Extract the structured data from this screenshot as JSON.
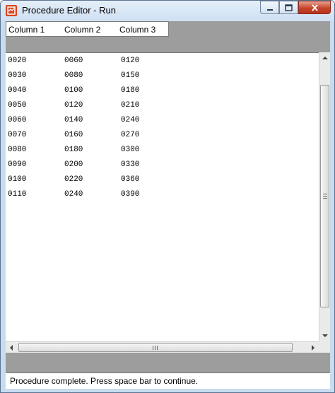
{
  "window": {
    "title": "Procedure Editor - Run",
    "icon": "app-logo-icon",
    "buttons": [
      "minimize-icon",
      "maximize-icon",
      "close-icon"
    ]
  },
  "columns": [
    "Column 1",
    "Column 2",
    "Column 3"
  ],
  "rows": [
    [
      "0020",
      "0060",
      "0120"
    ],
    [
      "0030",
      "0080",
      "0150"
    ],
    [
      "0040",
      "0100",
      "0180"
    ],
    [
      "0050",
      "0120",
      "0210"
    ],
    [
      "0060",
      "0140",
      "0240"
    ],
    [
      "0070",
      "0160",
      "0270"
    ],
    [
      "0080",
      "0180",
      "0300"
    ],
    [
      "0090",
      "0200",
      "0330"
    ],
    [
      "0100",
      "0220",
      "0360"
    ],
    [
      "0110",
      "0240",
      "0390"
    ]
  ],
  "status": "Procedure complete. Press space bar to continue.",
  "colors": {
    "titlebar": "#cfe0f2",
    "close": "#c7452c",
    "panel": "#9d9d9d"
  }
}
